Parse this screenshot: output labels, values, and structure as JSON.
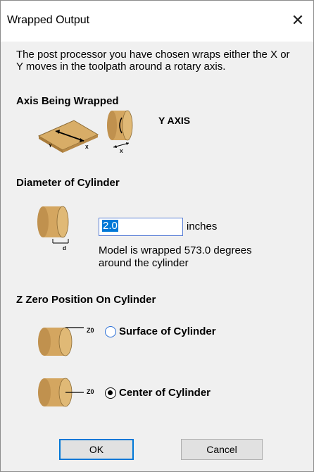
{
  "window": {
    "title": "Wrapped Output",
    "close_glyph": "✕"
  },
  "intro_text": "The post processor you have chosen wraps either the X or Y moves in the toolpath around a rotary axis.",
  "axis_section": {
    "heading": "Axis Being Wrapped",
    "value": "Y AXIS",
    "diagram_labels": {
      "y": "Y",
      "x": "X",
      "x2": "X"
    }
  },
  "diameter_section": {
    "heading": "Diameter of Cylinder",
    "value": "2.0",
    "units": "inches",
    "note": "Model is wrapped 573.0 degrees around the cylinder",
    "diagram_label": "d"
  },
  "z_section": {
    "heading": "Z Zero Position On Cylinder",
    "z0_label": "Z0",
    "options": [
      {
        "label": "Surface of Cylinder",
        "selected": false
      },
      {
        "label": "Center of Cylinder",
        "selected": true
      }
    ]
  },
  "buttons": {
    "ok": "OK",
    "cancel": "Cancel"
  },
  "colors": {
    "cylinder": "#d4a660",
    "cylinder_dark": "#a97b3a",
    "accent": "#0078d7"
  }
}
